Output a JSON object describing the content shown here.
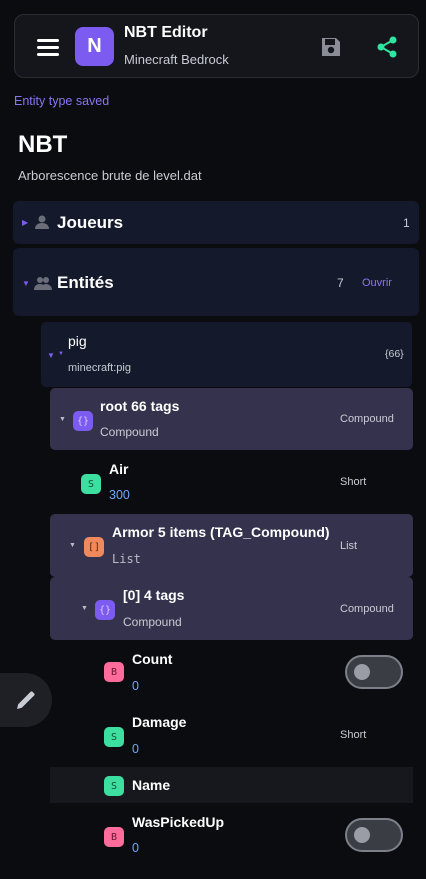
{
  "appbar": {
    "title": "NBT Editor",
    "subtitle": "Minecraft Bedrock",
    "icon_letter": "N",
    "menu_icon": "hamburger-menu-icon",
    "save_icon": "floppy-save-icon",
    "share_icon": "share-icon"
  },
  "status_text": "Entity type saved",
  "heading": "NBT",
  "subheading": "Arborescence brute de level.dat",
  "sections": {
    "joueurs": {
      "title": "Joueurs",
      "count": "1"
    },
    "entites": {
      "title": "Entités",
      "count": "7",
      "action": "Ouvrir"
    }
  },
  "entity": {
    "name": "pig",
    "id": "minecraft:pig",
    "tag_count": "{66}"
  },
  "tree": {
    "root": {
      "badge": "{}",
      "name": "root 66 tags",
      "sub": "Compound",
      "type": "Compound"
    },
    "air": {
      "badge": "S",
      "name": "Air",
      "value": "300",
      "type": "Short"
    },
    "armor": {
      "badge": "[]",
      "name": "Armor 5 items (TAG_Compound)",
      "sub": "List",
      "type": "List"
    },
    "item0": {
      "badge": "{}",
      "name": "[0] 4 tags",
      "sub": "Compound",
      "type": "Compound"
    },
    "count": {
      "badge": "B",
      "name": "Count",
      "value": "0",
      "toggle_on": false
    },
    "damage": {
      "badge": "S",
      "name": "Damage",
      "value": "0",
      "type": "Short"
    },
    "name_tag": {
      "badge": "S",
      "name": "Name"
    },
    "waspickedup": {
      "badge": "B",
      "name": "WasPickedUp",
      "value": "0",
      "toggle_on": false
    }
  },
  "fab_icon": "pencil-edit-icon",
  "colors": {
    "accent": "#7c5cf0",
    "background": "#0b0c10",
    "compound_badge": "#7c5cf0",
    "list_badge": "#f08a5d",
    "short_badge": "#3ddfa0",
    "byte_badge": "#ff6b9a",
    "value_blue": "#6fa8ff",
    "share_green": "#2ee6a0"
  }
}
